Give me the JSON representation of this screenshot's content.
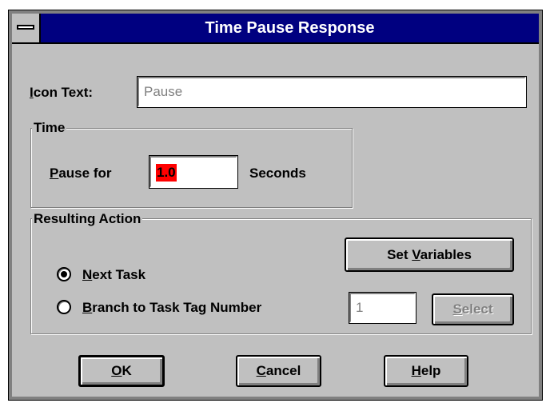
{
  "window": {
    "title": "Time Pause Response"
  },
  "icon_text": {
    "label": "Icon Text:",
    "accesskey": "I",
    "label_rest": "con Text:",
    "value": "Pause"
  },
  "time_group": {
    "title": "Time",
    "pause_label_key": "P",
    "pause_label_rest": "ause for",
    "value": "1.0",
    "unit": "Seconds"
  },
  "action_group": {
    "title": "Resulting Action",
    "set_variables": {
      "pre": "Set ",
      "key": "V",
      "post": "ariables"
    },
    "next_task": {
      "key": "N",
      "rest": "ext Task",
      "selected": true
    },
    "branch": {
      "key": "B",
      "rest": "ranch to Task Tag Number",
      "selected": false
    },
    "tag_number": "1",
    "select": {
      "key": "S",
      "rest": "elect",
      "enabled": false
    }
  },
  "buttons": {
    "ok": {
      "key": "O",
      "rest": "K"
    },
    "cancel": {
      "key": "C",
      "rest": "ancel"
    },
    "help": {
      "key": "H",
      "rest": "elp"
    }
  },
  "colors": {
    "title_bar": "#000080",
    "face": "#c0c0c0",
    "highlight_field": "#ff0000"
  }
}
